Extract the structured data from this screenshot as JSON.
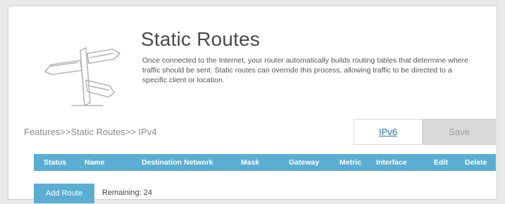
{
  "page": {
    "title": "Static Routes",
    "description": "Once connected to the Internet, your router automatically builds routing tables that determine where traffic should be sent. Static routes can override this process, allowing traffic to be directed to a specific client or location."
  },
  "breadcrumb": "Features>>Static Routes>> IPv4",
  "toolbar": {
    "ipv6_label": "IPv6",
    "save_label": "Save"
  },
  "table": {
    "columns": [
      "Status",
      "Name",
      "Destination Network",
      "Mask",
      "Gateway",
      "Metric",
      "Interface",
      "Edit",
      "Delete"
    ]
  },
  "actions": {
    "add_route_label": "Add Route",
    "remaining_text": "Remaining: 24"
  },
  "colors": {
    "accent": "#5aaed2",
    "save_disabled": "#d9d9d9",
    "link": "#2a6fb0"
  },
  "icons": {
    "header_illustration": "signpost-icon"
  }
}
